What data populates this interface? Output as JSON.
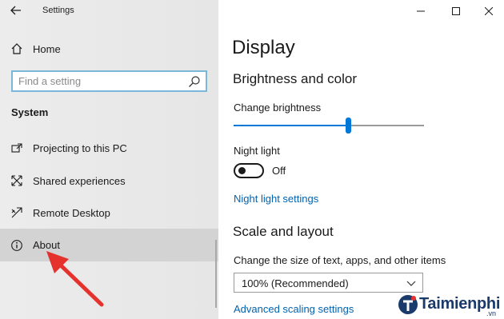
{
  "window": {
    "title": "Settings"
  },
  "sidebar": {
    "home_label": "Home",
    "search": {
      "placeholder": "Find a setting"
    },
    "section_label": "System",
    "items": [
      {
        "label": "Projecting to this PC",
        "icon": "projecting-icon"
      },
      {
        "label": "Shared experiences",
        "icon": "shared-experiences-icon"
      },
      {
        "label": "Remote Desktop",
        "icon": "remote-desktop-icon"
      },
      {
        "label": "About",
        "icon": "info-icon",
        "selected": true
      }
    ]
  },
  "main": {
    "page_title": "Display",
    "brightness": {
      "heading": "Brightness and color",
      "slider_label": "Change brightness",
      "slider_value_fraction": 0.6
    },
    "night_light": {
      "label": "Night light",
      "state": "Off",
      "settings_link": "Night light settings"
    },
    "scale": {
      "heading": "Scale and layout",
      "size_label": "Change the size of text, apps, and other items",
      "size_value": "100% (Recommended)",
      "advanced_link": "Advanced scaling settings"
    }
  },
  "watermark": {
    "brand": "Taimienphi",
    "suffix": ".vn"
  },
  "colors": {
    "accent": "#0078d7",
    "link": "#0063b1",
    "arrow": "#e5322d",
    "sidebar_bg": "#e8e8e8"
  }
}
